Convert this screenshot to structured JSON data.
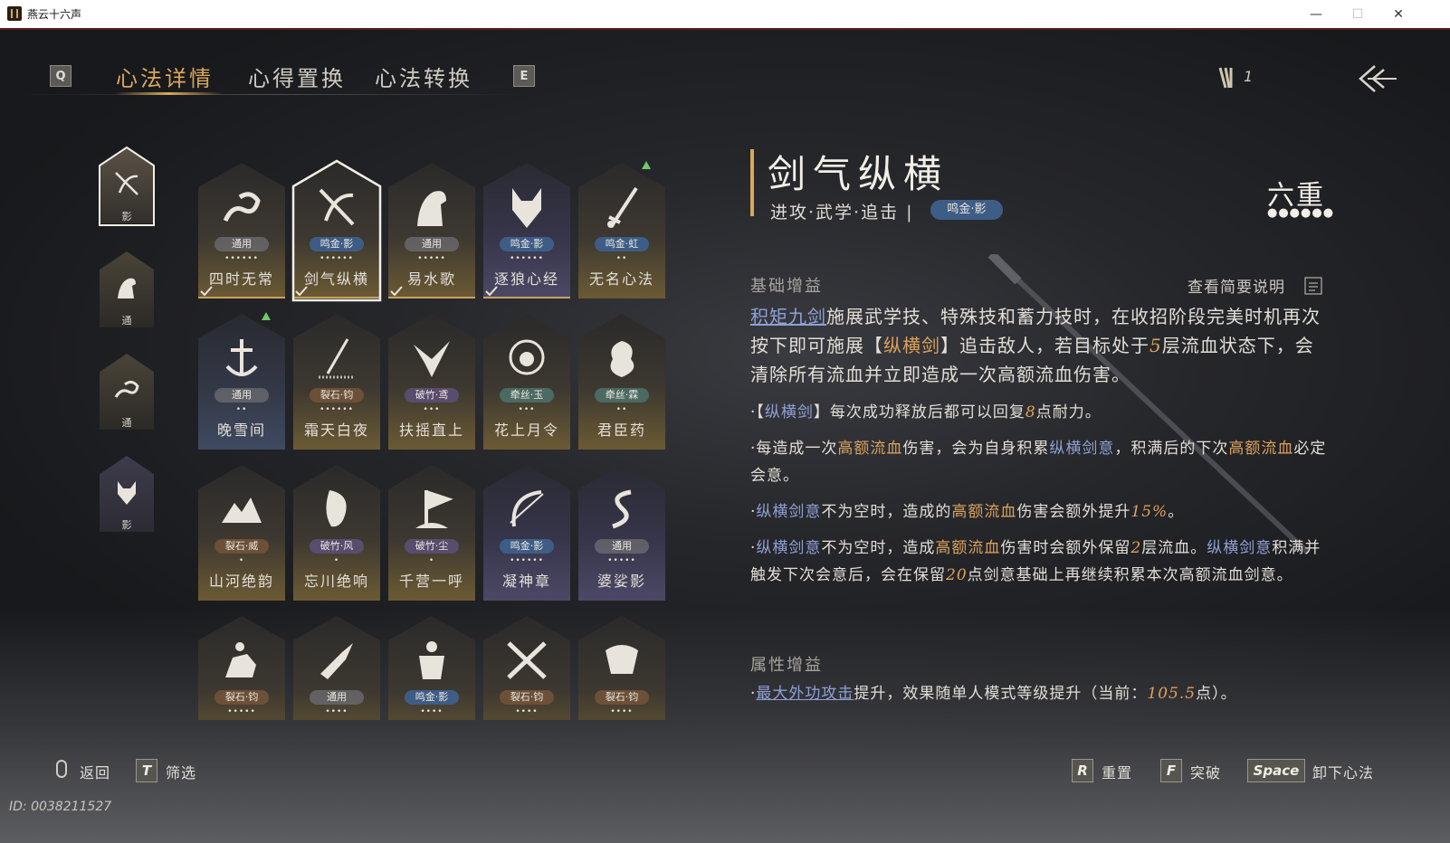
{
  "window": {
    "title": "燕云十六声",
    "minimize": "—",
    "maximize": "☐",
    "close": "✕"
  },
  "nav": {
    "key_left": "Q",
    "key_right": "E",
    "tabs": [
      "心法详情",
      "心得置换",
      "心法转换"
    ],
    "active_tab": 0,
    "currency_count": "1"
  },
  "equipped": [
    {
      "icon": "sword-bow-icon",
      "tag": "影",
      "selected": true
    },
    {
      "icon": "horse-icon",
      "tag": "通",
      "selected": false
    },
    {
      "icon": "dragon-cloud-icon",
      "tag": "通",
      "selected": false
    },
    {
      "icon": "wolf-icon",
      "tag": "影",
      "selected": false
    }
  ],
  "cards": [
    {
      "name": "四时无常",
      "badge": "通用",
      "badge_style": "gray",
      "dots": "••••••",
      "theme": "gold",
      "icon": "dragon-cloud-icon",
      "equipped": true
    },
    {
      "name": "剑气纵横",
      "badge": "鸣金·影",
      "badge_style": "blue",
      "dots": "••••••",
      "theme": "gold",
      "icon": "sword-bow-icon",
      "equipped": true,
      "selected": true
    },
    {
      "name": "易水歌",
      "badge": "通用",
      "badge_style": "gray",
      "dots": "•••••",
      "theme": "gold",
      "icon": "horse-icon",
      "equipped": true
    },
    {
      "name": "逐狼心经",
      "badge": "鸣金·影",
      "badge_style": "blue",
      "dots": "••••••",
      "theme": "purple",
      "icon": "wolf-icon",
      "equipped": true
    },
    {
      "name": "无名心法",
      "badge": "鸣金·虹",
      "badge_style": "blue",
      "dots": "••",
      "theme": "gold",
      "icon": "sword-icon",
      "upgrade": true
    },
    {
      "name": "晚雪间",
      "badge": "通用",
      "badge_style": "gray",
      "dots": "••",
      "theme": "blue",
      "icon": "anchor-sword-icon",
      "upgrade": true
    },
    {
      "name": "霜天白夜",
      "badge": "裂石·钧",
      "badge_style": "brown",
      "dots": "••••••",
      "theme": "gold",
      "icon": "spear-icon"
    },
    {
      "name": "扶摇直上",
      "badge": "破竹·鸢",
      "badge_style": "purple",
      "dots": "•••",
      "theme": "gold",
      "icon": "eagle-icon"
    },
    {
      "name": "花上月令",
      "badge": "牵丝·玉",
      "badge_style": "teal",
      "dots": "•••",
      "theme": "gold",
      "icon": "flower-moon-icon"
    },
    {
      "name": "君臣药",
      "badge": "牵丝·霖",
      "badge_style": "teal",
      "dots": "••",
      "theme": "gold",
      "icon": "gourd-icon"
    },
    {
      "name": "山河绝韵",
      "badge": "裂石·威",
      "badge_style": "brown",
      "dots": "•",
      "theme": "gold",
      "icon": "mountain-icon"
    },
    {
      "name": "忘川绝响",
      "badge": "破竹·风",
      "badge_style": "purple",
      "dots": "•",
      "theme": "gold",
      "icon": "mask-icon"
    },
    {
      "name": "千营一呼",
      "badge": "破竹·尘",
      "badge_style": "purple",
      "dots": "•",
      "theme": "gold",
      "icon": "flag-icon"
    },
    {
      "name": "凝神章",
      "badge": "鸣金·影",
      "badge_style": "blue",
      "dots": "••••••",
      "theme": "purple",
      "icon": "bow-icon"
    },
    {
      "name": "婆娑影",
      "badge": "通用",
      "badge_style": "gray",
      "dots": "•••••",
      "theme": "purple",
      "icon": "dragon-icon"
    },
    {
      "name": "",
      "badge": "裂石·钧",
      "badge_style": "brown",
      "dots": "•••••",
      "theme": "gold",
      "icon": "rider-icon"
    },
    {
      "name": "",
      "badge": "通用",
      "badge_style": "gray",
      "dots": "••••",
      "theme": "gold",
      "icon": "hand-bird-icon"
    },
    {
      "name": "",
      "badge": "鸣金·影",
      "badge_style": "blue",
      "dots": "••••",
      "theme": "gold",
      "icon": "armor-icon"
    },
    {
      "name": "",
      "badge": "裂石·钧",
      "badge_style": "brown",
      "dots": "••••",
      "theme": "gold",
      "icon": "crossed-weapons-icon"
    },
    {
      "name": "",
      "badge": "裂石·钧",
      "badge_style": "brown",
      "dots": "••••",
      "theme": "gold",
      "icon": "ox-head-icon"
    }
  ],
  "detail": {
    "title": "剑气纵横",
    "subtitle": "进攻·武学·追击 |",
    "badge": "鸣金·影",
    "rank": "六重",
    "rank_dots": "●●●●●●",
    "basic_header": "基础增益",
    "brief_label": "查看简要说明",
    "p1_link": "积矩九剑",
    "p1_a": "施展武学技、特殊技和蓄力技时，在收招阶段完美时机再次按下即可施展【",
    "p1_hl": "纵横剑",
    "p1_b": "】追击敌人，若目标处于",
    "p1_num": "5",
    "p1_c": "层流血状态下，会清除所有流血并立即造成一次高额流血伤害。",
    "b1_a": "·【",
    "b1_link": "纵横剑",
    "b1_b": "】每次成功释放后都可以回复",
    "b1_num": "8",
    "b1_c": "点耐力。",
    "b2_a": "·每造成一次",
    "b2_hl": "高额流血",
    "b2_b": "伤害，会为自身积累",
    "b2_link": "纵横剑意",
    "b2_c": "，积满后的下次",
    "b2_hl2": "高额流血",
    "b2_d": "必定会意。",
    "b3_a": "·",
    "b3_link": "纵横剑意",
    "b3_b": "不为空时，造成的",
    "b3_hl": "高额流血",
    "b3_c": "伤害会额外提升",
    "b3_num": "15%",
    "b3_d": "。",
    "b4_a": "·",
    "b4_link": "纵横剑意",
    "b4_b": "不为空时，造成",
    "b4_hl": "高额流血",
    "b4_c": "伤害时会额外保留",
    "b4_num": "2",
    "b4_d": "层流血。",
    "b4_link2": "纵横剑意",
    "b4_e": "积满并触发下次会意后，会在保留",
    "b4_num2": "20",
    "b4_f": "点剑意基础上再继续积累本次高额流血剑意。",
    "attr_header": "属性增益",
    "a1_a": "·",
    "a1_link": "最大外功攻击",
    "a1_b": "提升，效果随单人模式等级提升（当前：",
    "a1_num": "105.5",
    "a1_c": "点）。"
  },
  "bottom": {
    "back_label": "返回",
    "filter_key": "T",
    "filter_label": "筛选",
    "reset_key": "R",
    "reset_label": "重置",
    "break_key": "F",
    "break_label": "突破",
    "unequip_key": "Space",
    "unequip_label": "卸下心法",
    "id_text": "ID: 0038211527"
  },
  "colors": {
    "accent_gold": "#d9a85a",
    "link_blue": "#8fa0d6",
    "badge_blue": "#3e5d86",
    "upgrade_green": "#6ec96a"
  }
}
